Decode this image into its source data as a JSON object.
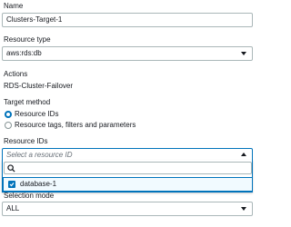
{
  "name": {
    "label": "Name",
    "value": "Clusters-Target-1"
  },
  "resource_type": {
    "label": "Resource type",
    "value": "aws:rds:db"
  },
  "actions": {
    "label": "Actions",
    "value": "RDS-Cluster-Failover"
  },
  "target_method": {
    "label": "Target method",
    "options": [
      {
        "label": "Resource IDs",
        "selected": true
      },
      {
        "label": "Resource tags, filters and parameters",
        "selected": false
      }
    ]
  },
  "resource_ids": {
    "label": "Resource IDs",
    "placeholder": "Select a resource ID",
    "search_value": "",
    "options": [
      {
        "label": "database-1",
        "checked": true
      }
    ]
  },
  "selection_mode": {
    "label": "Selection mode",
    "value": "ALL"
  },
  "colors": {
    "accent": "#0073bb",
    "border": "#aab7b8",
    "text": "#16191f",
    "muted": "#687078"
  }
}
